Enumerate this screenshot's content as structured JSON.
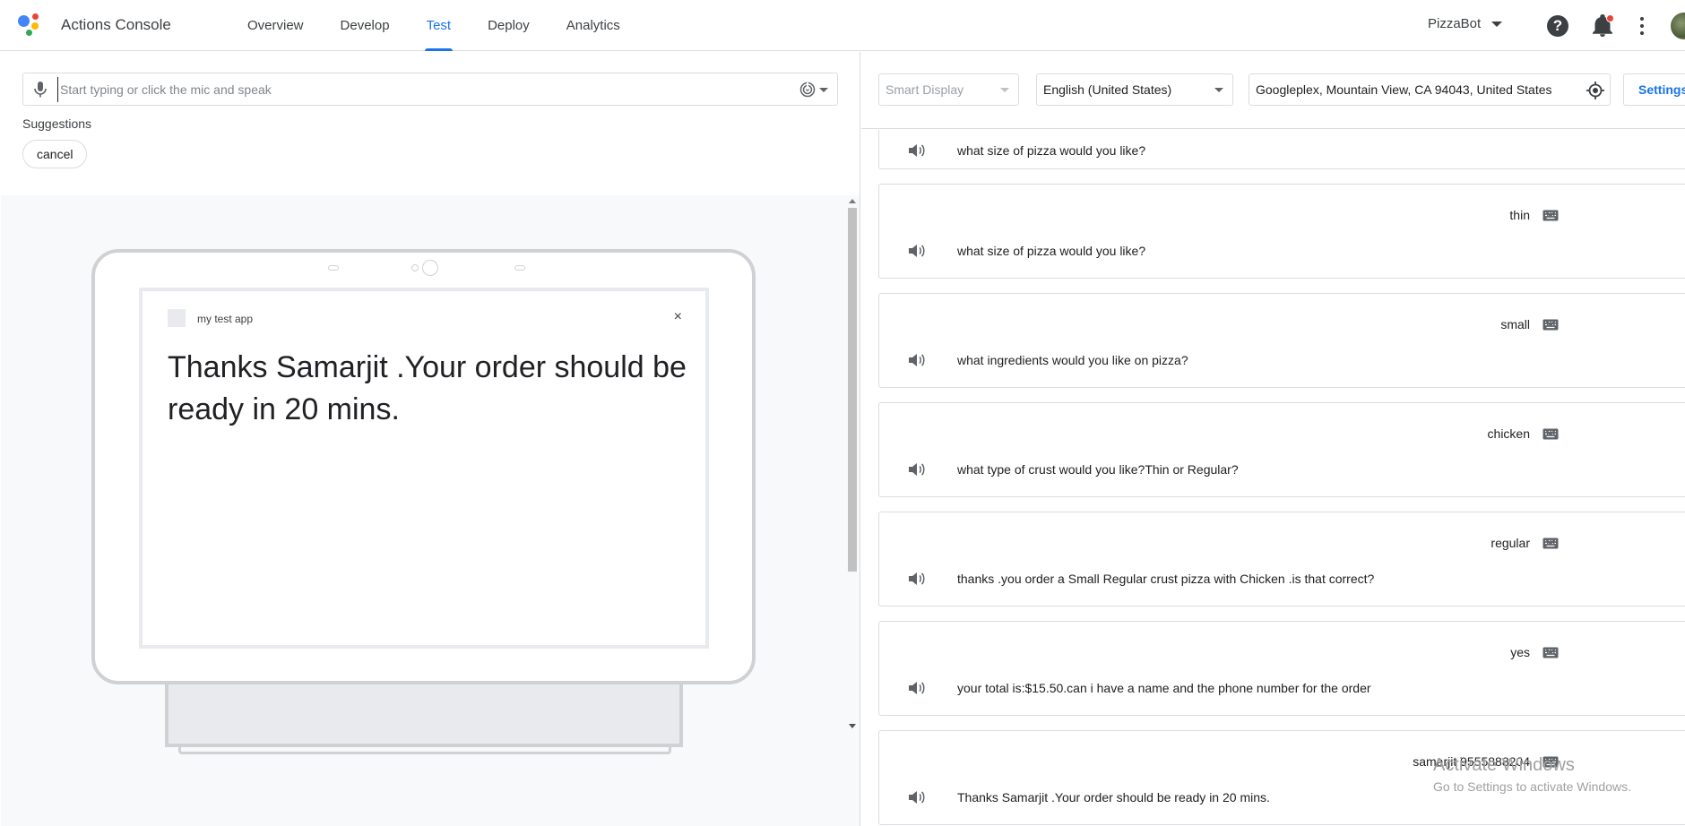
{
  "header": {
    "app_title": "Actions Console",
    "tabs": [
      {
        "label": "Overview",
        "active": false
      },
      {
        "label": "Develop",
        "active": false
      },
      {
        "label": "Test",
        "active": true
      },
      {
        "label": "Deploy",
        "active": false
      },
      {
        "label": "Analytics",
        "active": false
      }
    ],
    "project": "PizzaBot",
    "icons": [
      "google-logo-icon",
      "help-icon",
      "notifications-icon",
      "more-vert-icon",
      "avatar"
    ],
    "accent_color": "#1a73e8"
  },
  "input": {
    "placeholder": "Start typing or click the mic and speak",
    "value": ""
  },
  "suggestions": {
    "label": "Suggestions",
    "chips": [
      "cancel"
    ]
  },
  "simulator": {
    "app_name": "my test app",
    "close": "×",
    "response": "Thanks Samarjit .Your order should be ready in 20 mins."
  },
  "controls": {
    "surface": "Smart Display",
    "language": "English (United States)",
    "location": "Googleplex, Mountain View, CA 94043, United States",
    "settings": "Settings"
  },
  "transcript": [
    {
      "user": "",
      "agent": "what size of pizza would you like?"
    },
    {
      "user": "thin",
      "agent": "what size of pizza would you like?"
    },
    {
      "user": "small",
      "agent": "what ingredients would you like on pizza?"
    },
    {
      "user": "chicken",
      "agent": "what type of crust would you like?Thin or Regular?"
    },
    {
      "user": "regular",
      "agent": "thanks .you order a Small Regular crust pizza with Chicken .is that correct?"
    },
    {
      "user": "yes",
      "agent": "your total is:$15.50.can i have a name and the phone number for the order"
    },
    {
      "user": "samarjit 9555888204",
      "agent": "Thanks Samarjit .Your order should be ready in 20 mins."
    }
  ],
  "watermark": {
    "line1": "Activate Windows",
    "line2": "Go to Settings to activate Windows."
  }
}
